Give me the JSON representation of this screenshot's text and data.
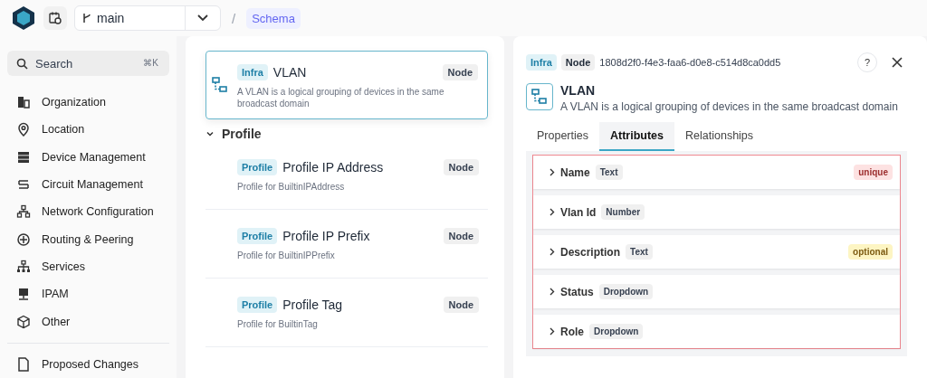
{
  "topbar": {
    "branch": "main",
    "separator": "/",
    "breadcrumb": "Schema"
  },
  "sidebar": {
    "search": {
      "placeholder": "Search",
      "shortcut": "⌘K"
    },
    "items": [
      {
        "label": "Organization"
      },
      {
        "label": "Location"
      },
      {
        "label": "Device Management"
      },
      {
        "label": "Circuit Management"
      },
      {
        "label": "Network Configuration"
      },
      {
        "label": "Routing & Peering"
      },
      {
        "label": "Services"
      },
      {
        "label": "IPAM"
      },
      {
        "label": "Other"
      }
    ],
    "footer_item": "Proposed Changes"
  },
  "schema_list": {
    "selected_node": {
      "namespace": "Infra",
      "name": "VLAN",
      "type": "Node",
      "description": "A VLAN is a logical grouping of devices in the same broadcast domain",
      "selected": true
    },
    "group": {
      "title": "Profile",
      "expanded": true,
      "nodes": [
        {
          "namespace": "Profile",
          "name": "Profile IP Address",
          "type": "Node",
          "description": "Profile for BuiltinIPAddress"
        },
        {
          "namespace": "Profile",
          "name": "Profile IP Prefix",
          "type": "Node",
          "description": "Profile for BuiltinIPPrefix"
        },
        {
          "namespace": "Profile",
          "name": "Profile Tag",
          "type": "Node",
          "description": "Profile for BuiltinTag"
        }
      ]
    }
  },
  "details": {
    "namespace": "Infra",
    "type": "Node",
    "id": "1808d2f0-f4e3-faa6-d0e8-c514d8ca0dd5",
    "help": "?",
    "title": "VLAN",
    "description": "A VLAN is a logical grouping of devices in the same broadcast domain",
    "tabs": [
      {
        "label": "Properties",
        "selected": false
      },
      {
        "label": "Attributes",
        "selected": true
      },
      {
        "label": "Relationships",
        "selected": false
      }
    ],
    "attributes": [
      {
        "name": "Name",
        "type": "Text",
        "flag": {
          "kind": "unique",
          "text": "unique"
        }
      },
      {
        "name": "Vlan Id",
        "type": "Number"
      },
      {
        "name": "Description",
        "type": "Text",
        "flag": {
          "kind": "optional",
          "text": "optional"
        }
      },
      {
        "name": "Status",
        "type": "Dropdown"
      },
      {
        "name": "Role",
        "type": "Dropdown"
      }
    ]
  }
}
